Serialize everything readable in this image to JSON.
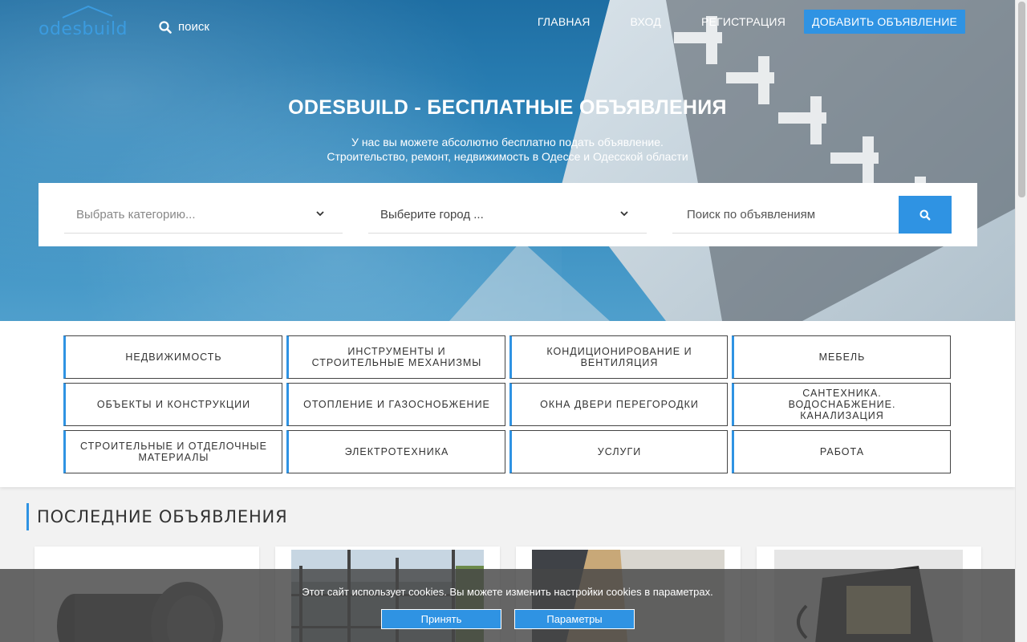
{
  "header": {
    "logo_text": "odesbuild",
    "search_label": "поиск",
    "nav": [
      "ГЛАВНАЯ",
      "ВХОД",
      "РЕГИСТРАЦИЯ"
    ],
    "add_button": "ДОБАВИТЬ ОБЪЯВЛЕНИЕ"
  },
  "hero": {
    "title": "ODESBUILD - БЕСПЛАТНЫЕ ОБЪЯВЛЕНИЯ",
    "subtitle_line1": "У нас вы можете абсолютно бесплатно подать объявление.",
    "subtitle_line2": "Строительство, ремонт, недвижимость в Одессе и Одесской области"
  },
  "search": {
    "category_placeholder": "Выбрать категорию...",
    "city_placeholder": "Выберите город ...",
    "query_placeholder": "Поиск по объявлениям"
  },
  "categories": [
    "НЕДВИЖИМОСТЬ",
    "ИНСТРУМЕНТЫ И СТРОИТЕЛЬНЫЕ МЕХАНИЗМЫ",
    "КОНДИЦИОНИРОВАНИЕ И ВЕНТИЛЯЦИЯ",
    "МЕБЕЛЬ",
    "ОБЪЕКТЫ И КОНСТРУКЦИИ",
    "ОТОПЛЕНИЕ И ГАЗОСНОБЖЕНИЕ",
    "ОКНА ДВЕРИ ПЕРЕГОРОДКИ",
    "САНТЕХНИКА. ВОДОСНАБЖЕНИЕ. КАНАЛИЗАЦИЯ",
    "СТРОИТЕЛЬНЫЕ И ОТДЕЛОЧНЫЕ МАТЕРИАЛЫ",
    "ЭЛЕКТРОТЕХНИКА",
    "УСЛУГИ",
    "РАБОТА"
  ],
  "latest": {
    "title": "ПОСЛЕДНИЕ ОБЪЯВЛЕНИЯ"
  },
  "cookie": {
    "text": "Этот сайт использует cookies. Вы можете изменить настройки cookies в параметрах.",
    "accept": "Принять",
    "settings": "Параметры"
  },
  "colors": {
    "accent": "#2f93e3",
    "hero_blue": "#2e86bb"
  }
}
